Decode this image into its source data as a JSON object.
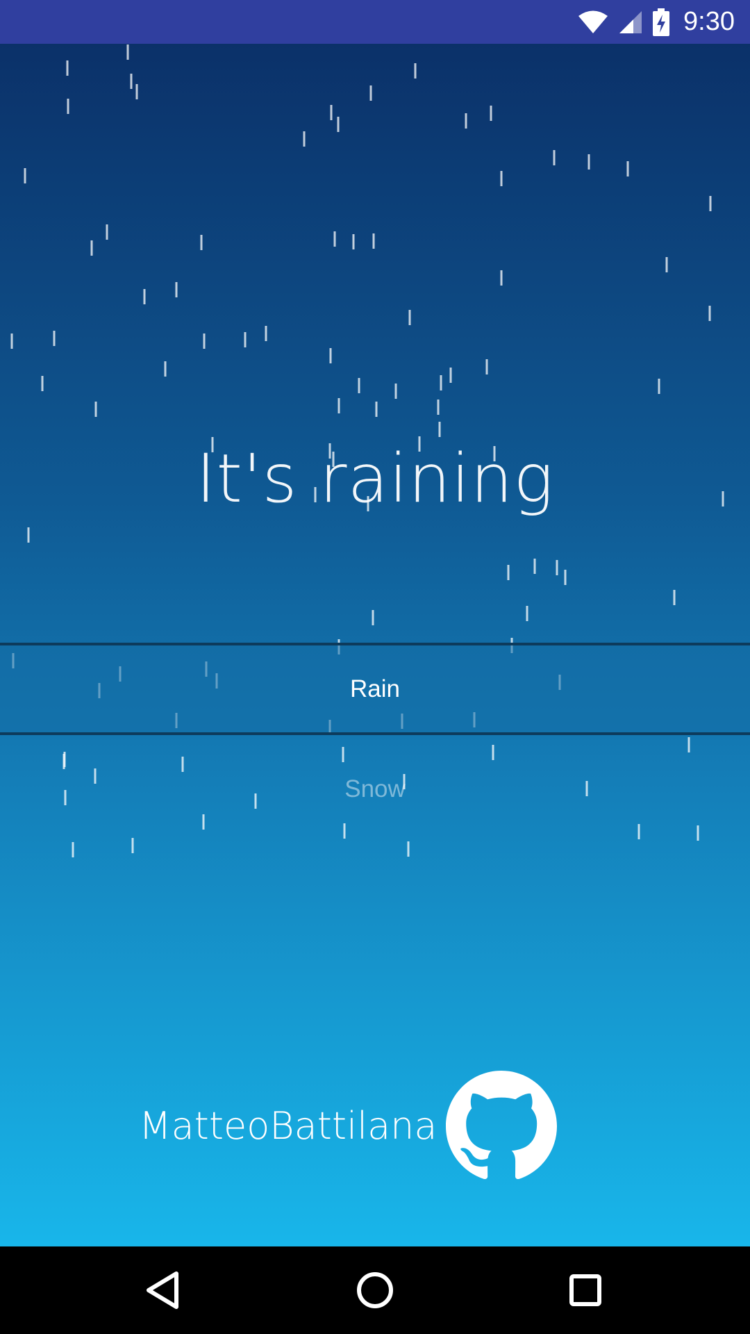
{
  "status_bar": {
    "time": "9:30",
    "icons": [
      "wifi-icon",
      "cell-signal-icon",
      "battery-charging-icon"
    ],
    "color": "#303f9f"
  },
  "main": {
    "headline": "It's raining",
    "weather_picker": {
      "selected": "Rain",
      "options": [
        "Rain",
        "Snow"
      ]
    },
    "author": "MatteoBattilana",
    "author_icon": "github-icon",
    "gradient_colors": [
      "#0b3169",
      "#18b6ea"
    ]
  },
  "nav_bar": {
    "icons": [
      "back-icon",
      "home-icon",
      "recents-icon"
    ]
  }
}
